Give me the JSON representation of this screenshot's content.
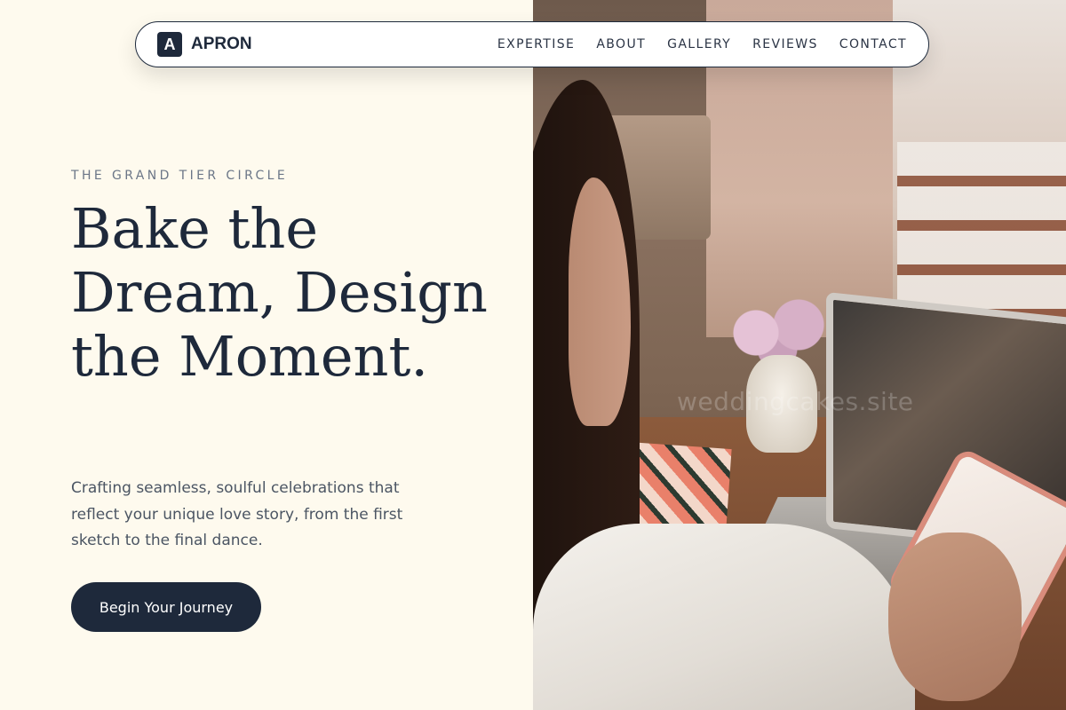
{
  "nav": {
    "brand_mark": "A",
    "brand_name": "APRON",
    "links": [
      "EXPERTISE",
      "ABOUT",
      "GALLERY",
      "REVIEWS",
      "CONTACT"
    ]
  },
  "hero": {
    "eyebrow": "THE GRAND TIER CIRCLE",
    "headline": "Bake the Dream, Design the Moment.",
    "subtext": "Crafting seamless, soulful celebrations that reflect your unique love story, from the first sketch to the final dance.",
    "cta_label": "Begin Your Journey",
    "photo_watermark": "weddingcakes.site"
  },
  "colors": {
    "background": "#fefaee",
    "primary": "#1e293b",
    "muted_text": "#6b7687",
    "body_text": "#4b5563"
  }
}
